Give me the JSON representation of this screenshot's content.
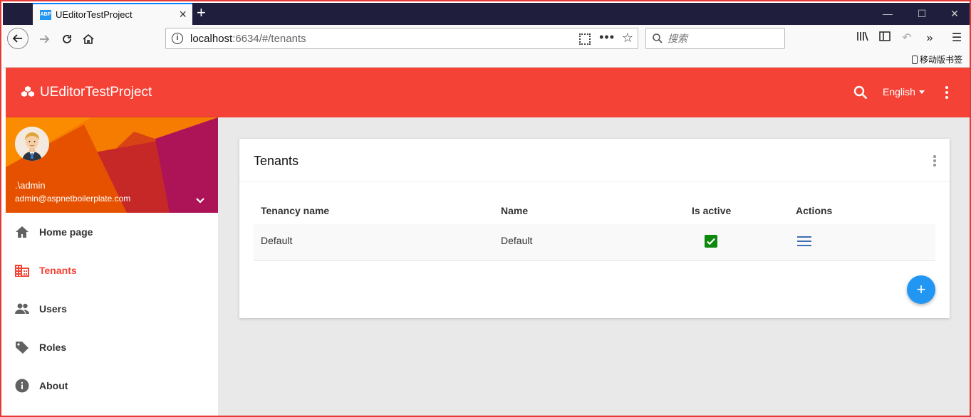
{
  "browser": {
    "tab_title": "UEditorTestProject",
    "favicon_text": "ABP",
    "tab_close": "×",
    "new_tab": "+",
    "url_host": "localhost",
    "url_path": ":6634/#/tenants",
    "url_more": "•••",
    "search_placeholder": "搜索",
    "mobile_bookmarks": "移动版书签",
    "window_controls": [
      "—",
      "☐",
      "✕"
    ]
  },
  "header": {
    "brand": "UEditorTestProject",
    "language": "English",
    "accent_color": "#f44336"
  },
  "user": {
    "name": ".\\admin",
    "email": "admin@aspnetboilerplate.com"
  },
  "sidebar": {
    "items": [
      {
        "label": "Home page",
        "icon": "home-icon"
      },
      {
        "label": "Tenants",
        "icon": "business-icon",
        "active": true
      },
      {
        "label": "Users",
        "icon": "people-icon"
      },
      {
        "label": "Roles",
        "icon": "label-tag-icon"
      },
      {
        "label": "About",
        "icon": "info-icon"
      }
    ]
  },
  "tenants": {
    "title": "Tenants",
    "columns": [
      "Tenancy name",
      "Name",
      "Is active",
      "Actions"
    ],
    "rows": [
      {
        "tenancy_name": "Default",
        "name": "Default",
        "is_active": true
      }
    ],
    "add_label": "+"
  }
}
